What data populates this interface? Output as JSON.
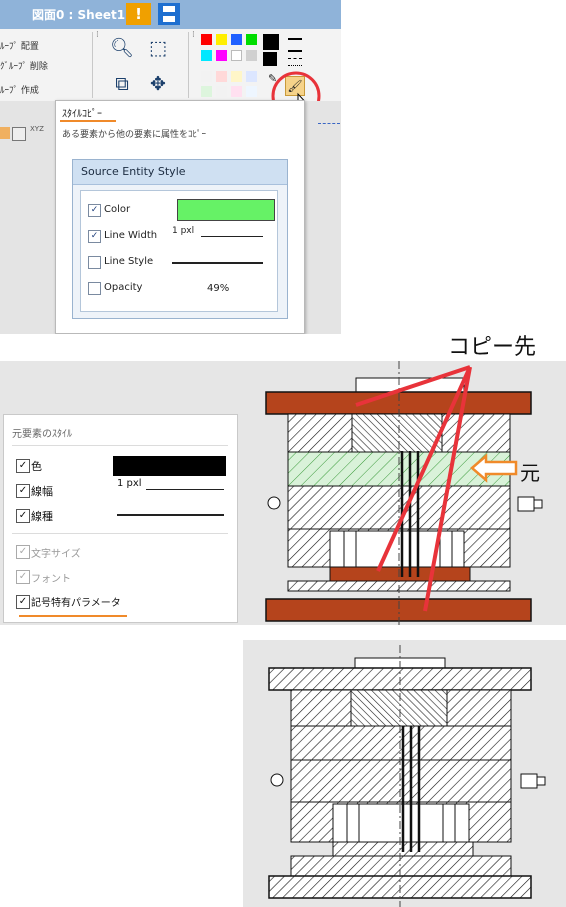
{
  "window": {
    "title": "図面0 : Sheet1",
    "warn_glyph": "!"
  },
  "ribbon": {
    "group_left": [
      "ﾙｰﾌﾟ 配置",
      "ｸﾞﾙｰﾌﾟ 削除",
      "ﾙｰﾌﾟ 作成"
    ],
    "palette_colors": [
      "#ff0000",
      "#ffee00",
      "#2060ff",
      "#00dd00",
      "#000000",
      "#00e8ff",
      "#ff00ff",
      "#ffffff",
      "#d0d0d0",
      "#000000",
      "#f2f2f2",
      "#ffd9d9",
      "#fff6c8",
      "#dce6ff",
      "#ddf5dd",
      "#f2f2f2",
      "#ffe0f0",
      "#eef6ff",
      "#e8e8e8",
      "#fafafa"
    ],
    "small_label": "XYZ"
  },
  "tooltip": {
    "title": "ｽﾀｲﾙｺﾋﾟｰ",
    "description": "ある要素から他の要素に属性をｺﾋﾟｰ",
    "dialog_title": "Source Entity Style",
    "rows": [
      {
        "label": "Color",
        "checked": true
      },
      {
        "label": "Line Width",
        "checked": true,
        "value": "1 pxl"
      },
      {
        "label": "Line Style",
        "checked": false
      },
      {
        "label": "Opacity",
        "checked": false,
        "value": "49%"
      }
    ],
    "color_value": "#66f266"
  },
  "callouts": {
    "copy_target": "コピー先",
    "original": "元"
  },
  "panel": {
    "title": "元要素のｽﾀｲﾙ",
    "items": [
      {
        "label": "色",
        "checked": true,
        "disabled": false
      },
      {
        "label": "線幅",
        "checked": true,
        "disabled": false,
        "value": "1 pxl"
      },
      {
        "label": "線種",
        "checked": true,
        "disabled": false
      },
      {
        "label": "文字サイズ",
        "checked": true,
        "disabled": true
      },
      {
        "label": "フォント",
        "checked": true,
        "disabled": true
      },
      {
        "label": "記号特有パラメータ",
        "checked": true,
        "disabled": false
      }
    ],
    "check_glyph": "✓"
  },
  "colors": {
    "accent_orange": "#f08a2a",
    "arrow_red": "#e8333a",
    "plate_red": "#b5441c",
    "highlight_green": "#66f266"
  }
}
